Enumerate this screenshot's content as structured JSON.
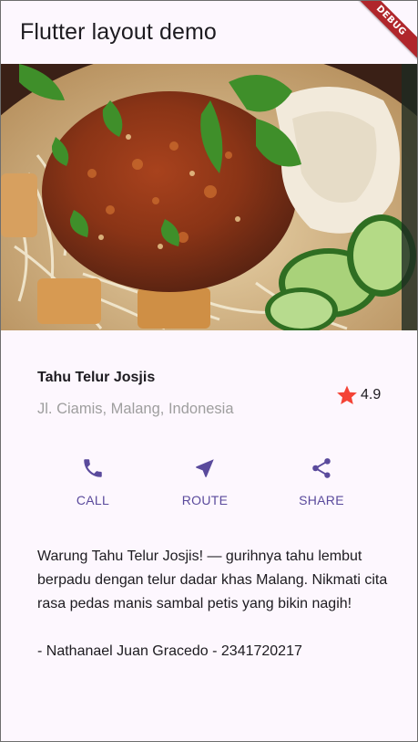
{
  "appbar": {
    "title": "Flutter layout demo"
  },
  "debug_banner": "DEBUG",
  "image": {
    "alt": "Tahu Telur dish"
  },
  "place": {
    "name": "Tahu Telur Josjis",
    "location": "Jl. Ciamis, Malang, Indonesia",
    "rating": "4.9"
  },
  "actions": [
    {
      "label": "CALL",
      "icon": "phone-icon"
    },
    {
      "label": "ROUTE",
      "icon": "near-me-icon"
    },
    {
      "label": "SHARE",
      "icon": "share-icon"
    }
  ],
  "description": "Warung Tahu Telur Josjis! — gurihnya tahu lembut berpadu dengan telur dadar khas Malang. Nikmati cita rasa pedas manis sambal petis yang bikin nagih!\n\n- Nathanael Juan Gracedo - 2341720217",
  "colors": {
    "background": "#fdf7fe",
    "accent": "#5a4a9c",
    "star": "#f44336",
    "subtitle": "#9e9e9e"
  }
}
